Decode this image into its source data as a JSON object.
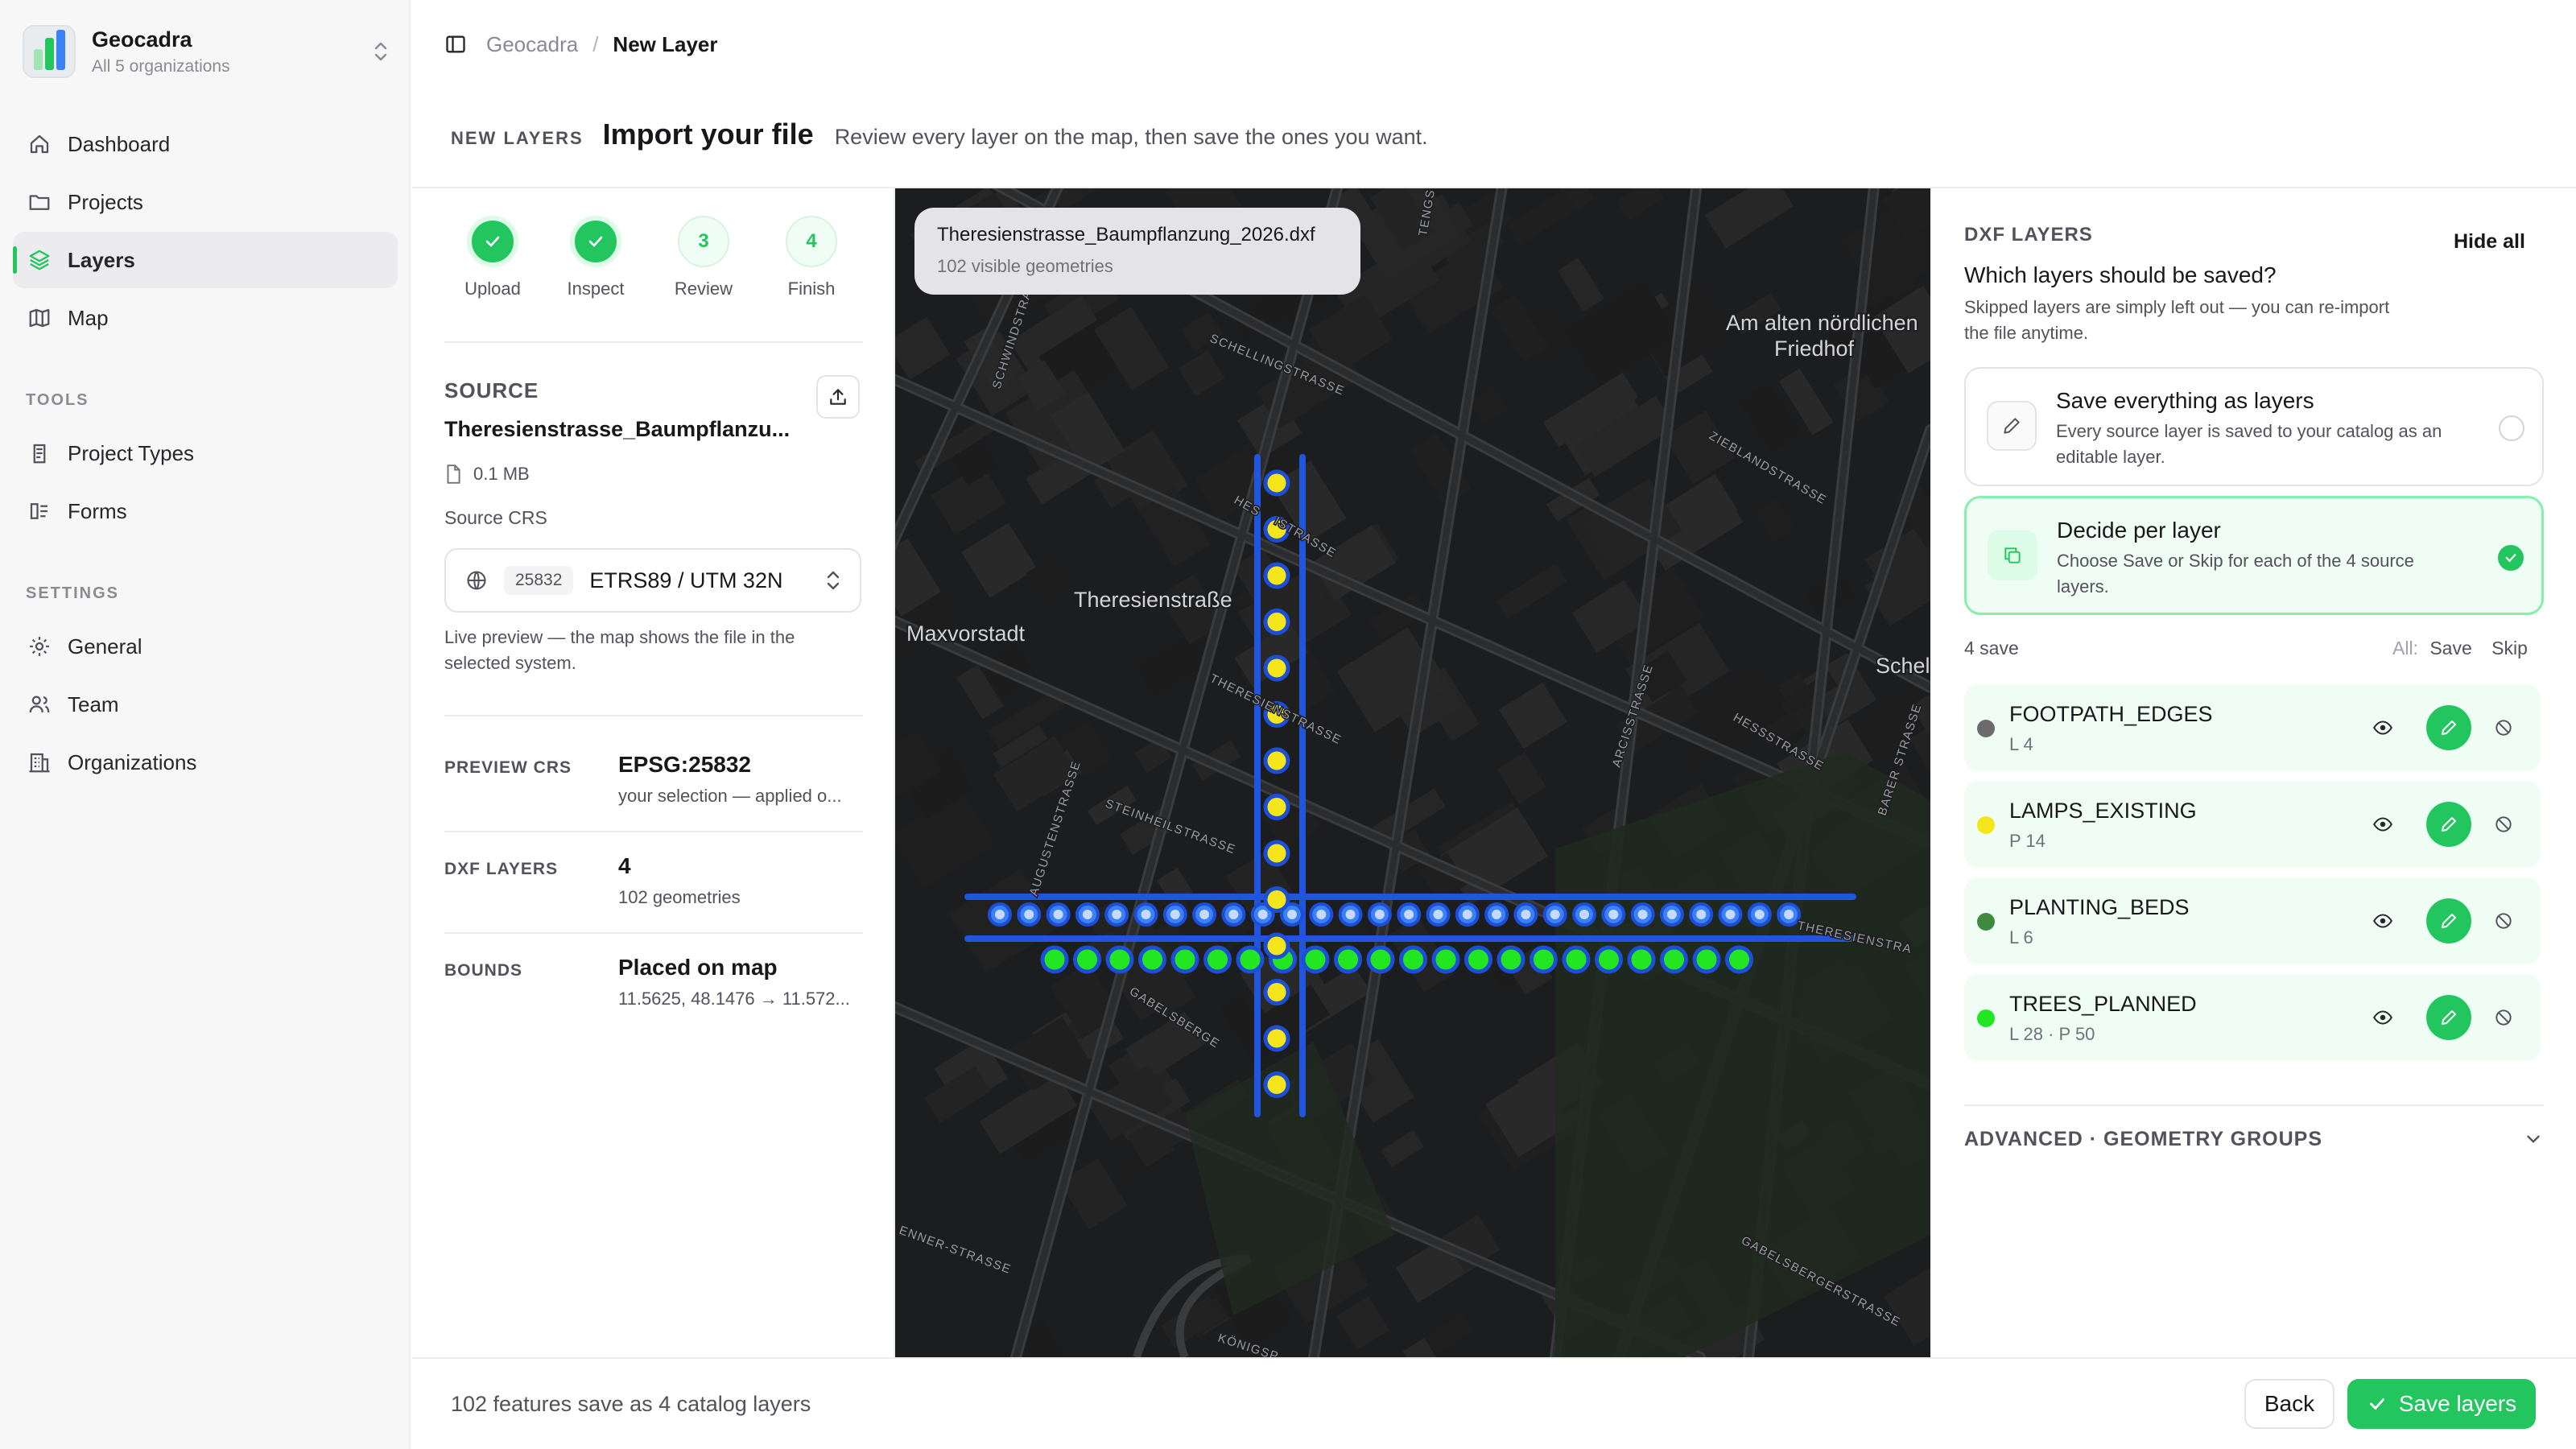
{
  "sidebar": {
    "org_name": "Geocadra",
    "org_sub": "All 5 organizations",
    "nav": [
      {
        "label": "Dashboard",
        "icon": "home-icon"
      },
      {
        "label": "Projects",
        "icon": "folder-icon"
      },
      {
        "label": "Layers",
        "icon": "layers-icon",
        "active": true
      },
      {
        "label": "Map",
        "icon": "map-icon"
      }
    ],
    "tools_heading": "TOOLS",
    "tools": [
      {
        "label": "Project Types",
        "icon": "clipboard-icon"
      },
      {
        "label": "Forms",
        "icon": "form-icon"
      }
    ],
    "settings_heading": "SETTINGS",
    "settings": [
      {
        "label": "General",
        "icon": "gear-icon"
      },
      {
        "label": "Team",
        "icon": "users-icon"
      },
      {
        "label": "Organizations",
        "icon": "building-icon"
      }
    ]
  },
  "breadcrumb": {
    "root": "Geocadra",
    "sep": "/",
    "current": "New Layer"
  },
  "header": {
    "eyebrow": "NEW LAYERS",
    "title": "Import your file",
    "description": "Review every layer on the map, then save the ones you want."
  },
  "steps": [
    {
      "label": "Upload",
      "status": "done",
      "num": ""
    },
    {
      "label": "Inspect",
      "status": "done",
      "num": ""
    },
    {
      "label": "Review",
      "status": "todo",
      "num": "3"
    },
    {
      "label": "Finish",
      "status": "todo",
      "num": "4"
    }
  ],
  "source": {
    "heading": "SOURCE",
    "filename": "Theresienstrasse_Baumpflanzu...",
    "size": "0.1 MB",
    "crs_label": "Source CRS",
    "crs_code": "25832",
    "crs_name": "ETRS89 / UTM 32N",
    "live_note": "Live preview — the map shows the file in the selected system."
  },
  "details": [
    {
      "key": "PREVIEW CRS",
      "value": "EPSG:25832",
      "sub": "your selection — applied o..."
    },
    {
      "key": "DXF LAYERS",
      "value": "4",
      "sub": "102 geometries"
    },
    {
      "key": "BOUNDS",
      "value": "Placed on map",
      "sub": "11.5625, 48.1476 → 11.572..."
    }
  ],
  "map": {
    "card_title": "Theresienstrasse_Baumpflanzung_2026.dxf",
    "card_sub": "102 visible geometries",
    "labels": [
      {
        "text": "Am alten nördlichen",
        "kind": "place"
      },
      {
        "text": "Friedhof",
        "kind": "place"
      },
      {
        "text": "Theresienstraße",
        "kind": "place"
      },
      {
        "text": "Maxvorstadt",
        "kind": "place"
      },
      {
        "text": "Schel",
        "kind": "place"
      },
      {
        "text": "SCHELLINGSTRASSE",
        "kind": "street"
      },
      {
        "text": "SCHWINDSTRASSE",
        "kind": "street"
      },
      {
        "text": "ZIEBLANDSTRASSE",
        "kind": "street"
      },
      {
        "text": "THERESIENSTRASSE",
        "kind": "street"
      },
      {
        "text": "HESSSTRASSE",
        "kind": "street"
      },
      {
        "text": "ARCISSTRASSE",
        "kind": "street"
      },
      {
        "text": "BARER STRASSE",
        "kind": "street"
      },
      {
        "text": "GABELSBERGERSTRASSE",
        "kind": "street"
      },
      {
        "text": "STEINHEILSTRASSE",
        "kind": "street"
      },
      {
        "text": "AUGUSTENSTRASSE",
        "kind": "street"
      },
      {
        "text": "THERESIENSTRA",
        "kind": "street"
      },
      {
        "text": "TENGSTRASSE",
        "kind": "street"
      },
      {
        "text": "ENNER-STRASSE",
        "kind": "street"
      },
      {
        "text": "KÖNIGSP",
        "kind": "street"
      },
      {
        "text": "GABELSBERGE",
        "kind": "street"
      },
      {
        "text": "HES",
        "kind": "street"
      },
      {
        "text": "ISTRASSE",
        "kind": "street"
      }
    ],
    "colors": {
      "edge": "#2255dd",
      "lamp": "#f5e61b",
      "tree": "#22e622",
      "tree_ring": "#1d4ed8",
      "planting": "#3a6b3a"
    }
  },
  "right": {
    "eyebrow": "DXF LAYERS",
    "hide_all": "Hide all",
    "question": "Which layers should be saved?",
    "description": "Skipped layers are simply left out — you can re-import the file anytime.",
    "options": [
      {
        "title": "Save everything as layers",
        "desc": "Every source layer is saved to your catalog as an editable layer.",
        "selected": false,
        "icon": "pencil-icon"
      },
      {
        "title": "Decide per layer",
        "desc": "Choose Save or Skip for each of the 4 source layers.",
        "selected": true,
        "icon": "copy-icon"
      }
    ],
    "save_count": "4 save",
    "all_label": "All:",
    "all_save": "Save",
    "all_skip": "Skip",
    "layers": [
      {
        "name": "FOOTPATH_EDGES",
        "sub": "L 4",
        "color": "#6b6b6b"
      },
      {
        "name": "LAMPS_EXISTING",
        "sub": "P 14",
        "color": "#f5e61b"
      },
      {
        "name": "PLANTING_BEDS",
        "sub": "L 6",
        "color": "#3f8a3f"
      },
      {
        "name": "TREES_PLANNED",
        "sub": "L 28 · P 50",
        "color": "#22e622"
      }
    ],
    "advanced": "ADVANCED · GEOMETRY GROUPS"
  },
  "footer": {
    "summary": "102 features save as 4 catalog layers",
    "back": "Back",
    "save": "Save layers"
  },
  "accent": "#22c55e"
}
